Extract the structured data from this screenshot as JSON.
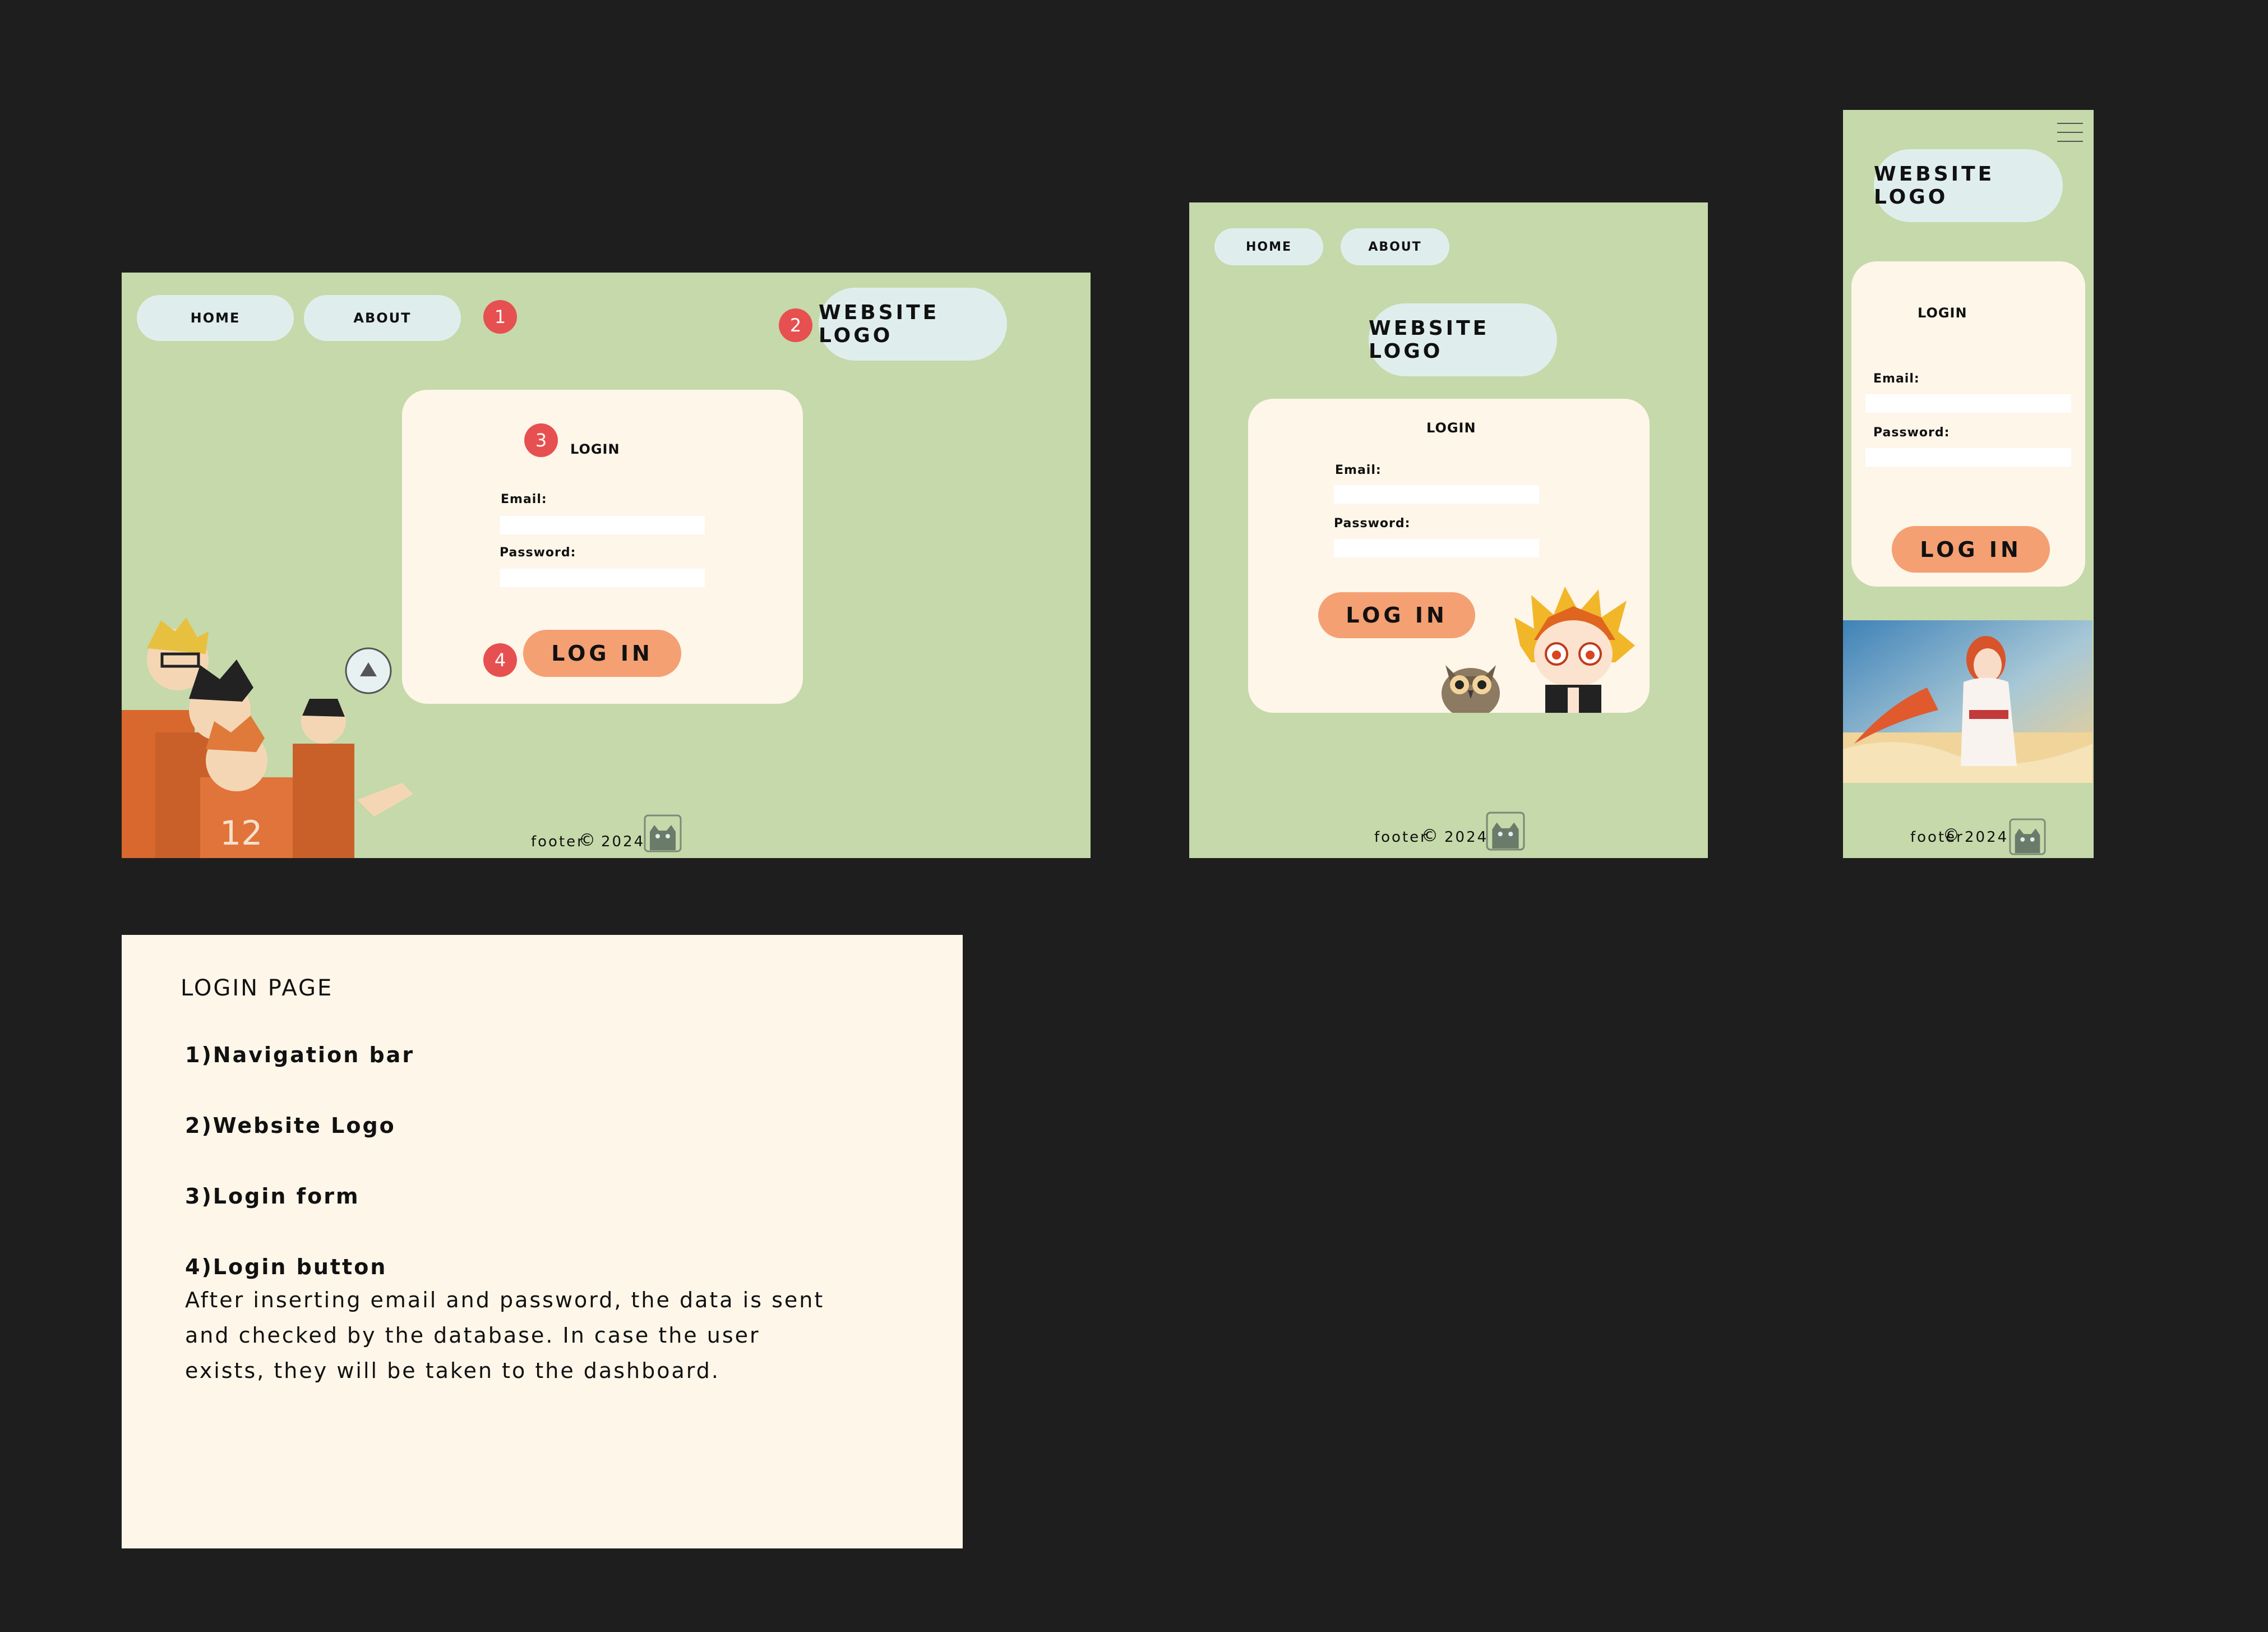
{
  "nav": {
    "home": "HOME",
    "about": "ABOUT"
  },
  "logo_text": "WEBSITE LOGO",
  "form": {
    "title": "LOGIN",
    "email_label": "Email:",
    "password_label": "Password:",
    "button": "LOG IN"
  },
  "footer": {
    "text": "footer",
    "symbol": "©",
    "year": "2024"
  },
  "badges": {
    "b1": "1",
    "b2": "2",
    "b3": "3",
    "b4": "4"
  },
  "notes": {
    "heading": "LOGIN PAGE",
    "item1": "1)Navigation bar",
    "item2": "2)Website Logo",
    "item3": "3)Login form",
    "item4": "4)Login button",
    "item4_desc": "After inserting email and password, the data is sent and checked by the database. In case the user exists, they will be taken to the dashboard."
  },
  "colors": {
    "canvas": "#1e1e1e",
    "frame_bg": "#c5d9aa",
    "pill_bg": "#dfeeed",
    "card_bg": "#fdf6e9",
    "button_bg": "#f4a073",
    "badge_bg": "#e75050"
  },
  "icons": [
    "hamburger-menu-icon",
    "copyright-icon",
    "cat-mascot-icon"
  ]
}
